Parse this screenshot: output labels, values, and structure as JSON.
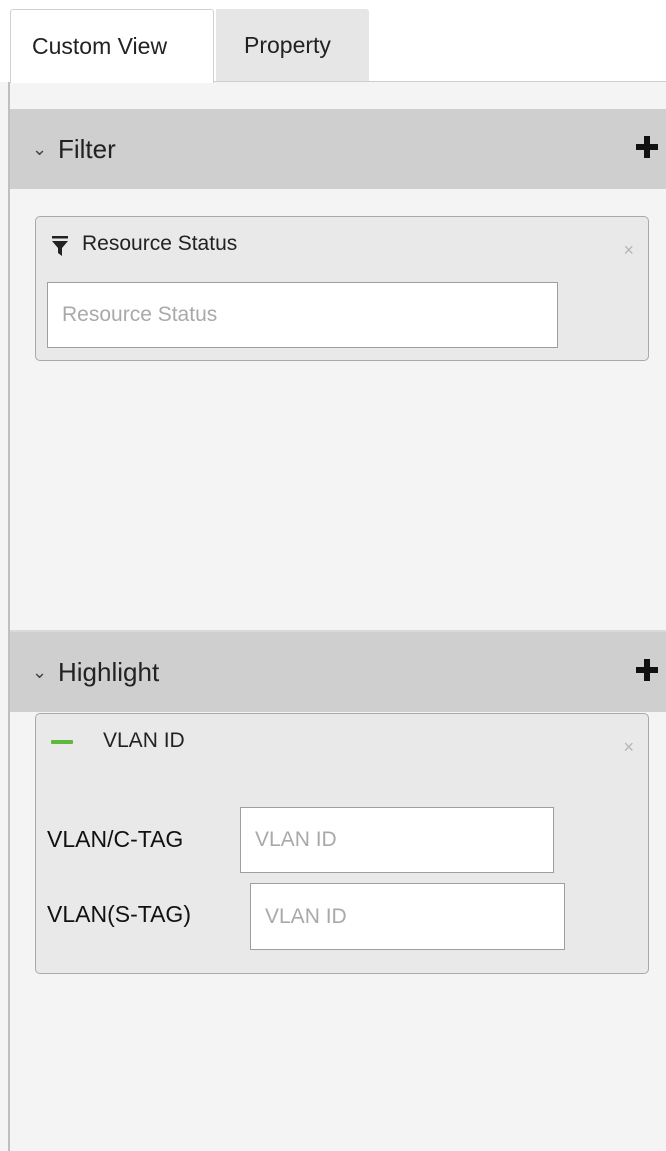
{
  "tabs": [
    {
      "label": "Custom View",
      "active": true
    },
    {
      "label": "Property",
      "active": false
    }
  ],
  "filter": {
    "title": "Filter",
    "add_icon": "plus-icon",
    "cards": [
      {
        "icon": "funnel-icon",
        "title": "Resource Status",
        "close_glyph": "×",
        "input_placeholder": "Resource Status",
        "input_value": ""
      }
    ]
  },
  "highlight": {
    "title": "Highlight",
    "add_icon": "plus-icon",
    "cards": [
      {
        "icon": "green-dash-icon",
        "color": "#5fb83c",
        "title": "VLAN ID",
        "close_glyph": "×",
        "fields": [
          {
            "label": "VLAN/C-TAG",
            "placeholder": "VLAN ID",
            "value": ""
          },
          {
            "label": "VLAN(S-TAG)",
            "placeholder": "VLAN ID",
            "value": ""
          }
        ]
      }
    ]
  },
  "icons": {
    "chevron": "⌄",
    "chevron_name": "chevron-down-icon"
  }
}
